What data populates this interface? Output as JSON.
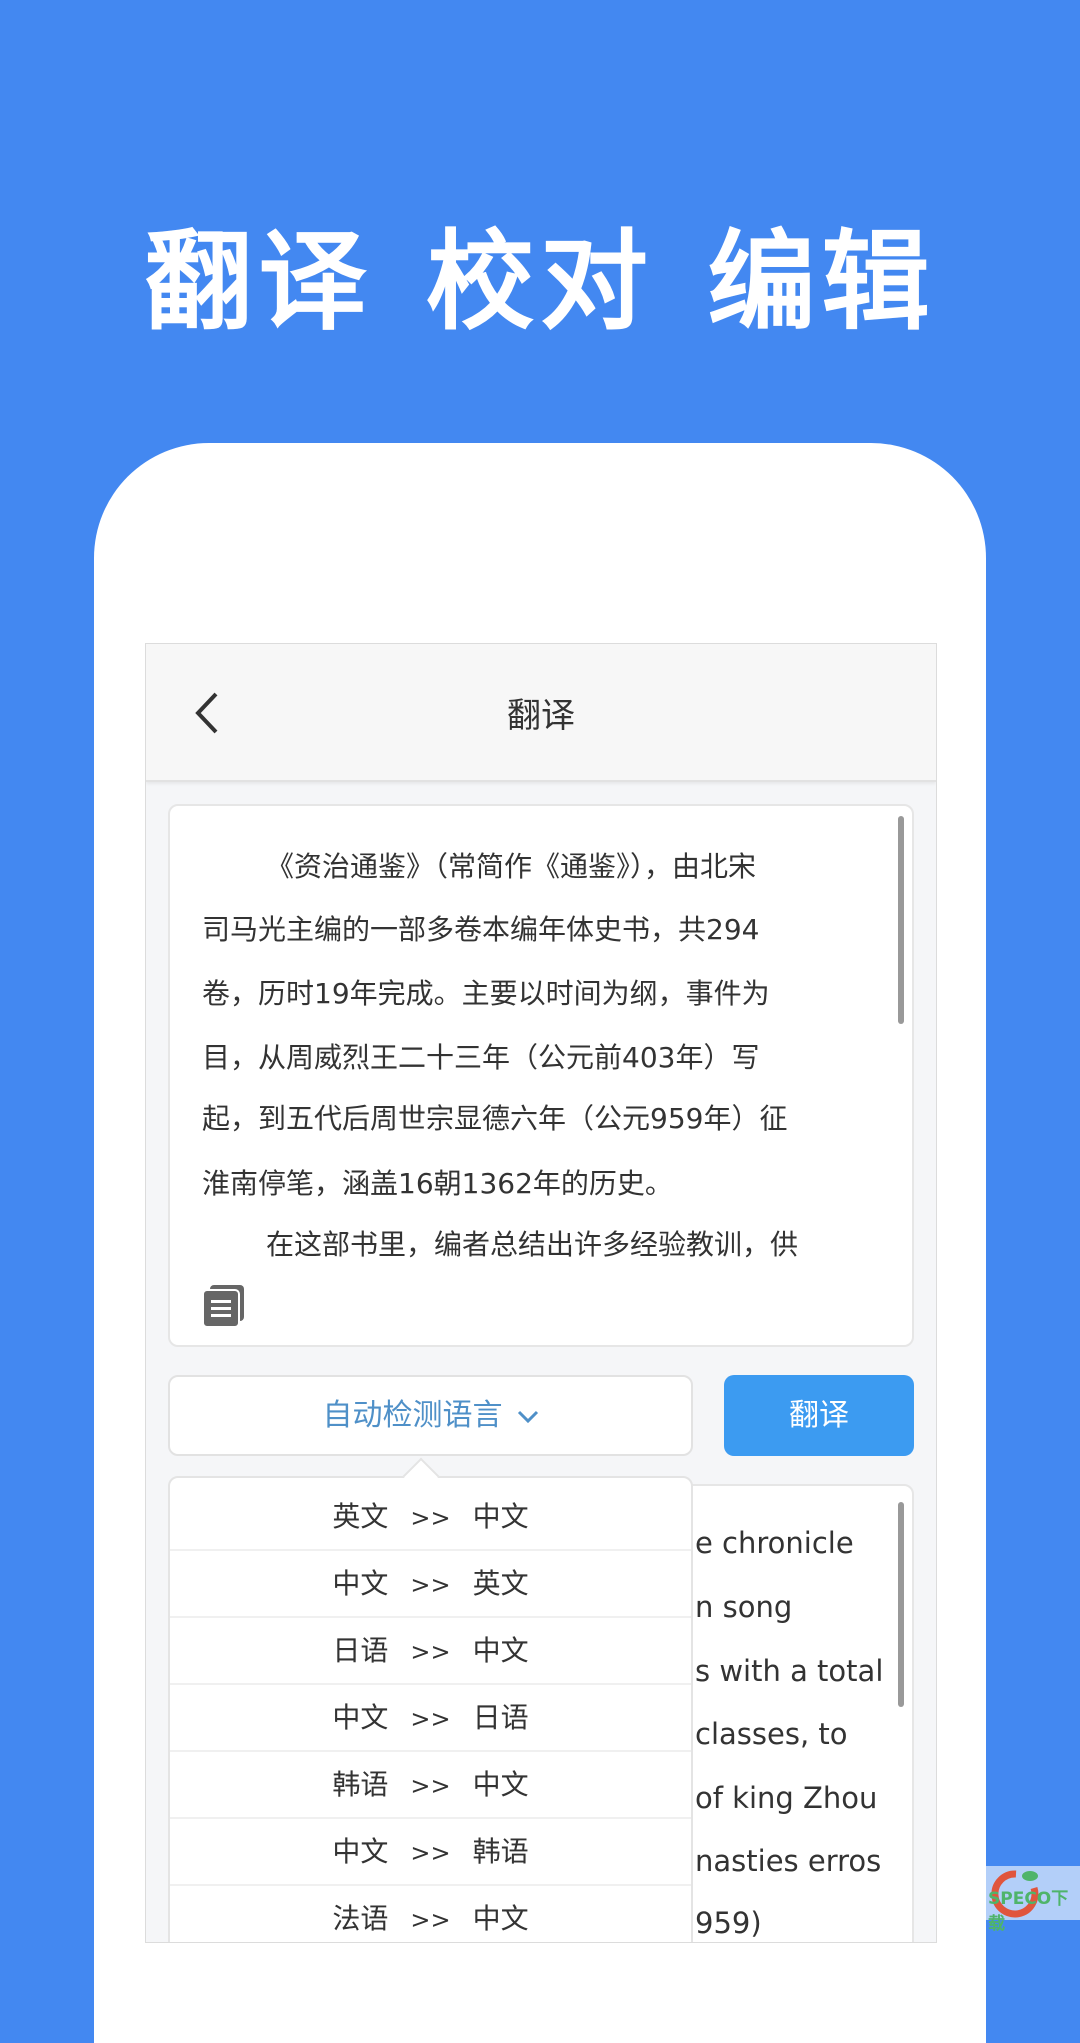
{
  "headline": "翻译 校对 编辑",
  "header": {
    "title": "翻译"
  },
  "source": {
    "lines": [
      "《资治通鉴》（常简作《通鉴》），由北宋",
      "司马光主编的一部多卷本编年体史书，共294",
      "卷，历时19年完成。主要以时间为纲，事件为",
      "目，从周威烈王二十三年（公元前403年）写",
      "起，到五代后周世宗显德六年（公元959年）征",
      "淮南停笔，涵盖16朝1362年的历史。",
      "在这部书里，编者总结出许多经验教训，供"
    ]
  },
  "language_select": {
    "value": "自动检测语言"
  },
  "translate_button": "翻译",
  "options": [
    {
      "from": "英文",
      "sep": ">>",
      "to": "中文"
    },
    {
      "from": "中文",
      "sep": ">>",
      "to": "英文"
    },
    {
      "from": "日语",
      "sep": ">>",
      "to": "中文"
    },
    {
      "from": "中文",
      "sep": ">>",
      "to": "日语"
    },
    {
      "from": "韩语",
      "sep": ">>",
      "to": "中文"
    },
    {
      "from": "中文",
      "sep": ">>",
      "to": "韩语"
    },
    {
      "from": "法语",
      "sep": ">>",
      "to": "中文"
    }
  ],
  "result": {
    "lines": [
      "e chronicle",
      "n song",
      "s with a total",
      "classes, to",
      "of king Zhou",
      "nasties erros",
      "959)"
    ]
  },
  "watermark": "SPECO下载",
  "colors": {
    "background": "#4388f1",
    "button": "#3c9bf1",
    "select_text": "#4f90c8"
  }
}
